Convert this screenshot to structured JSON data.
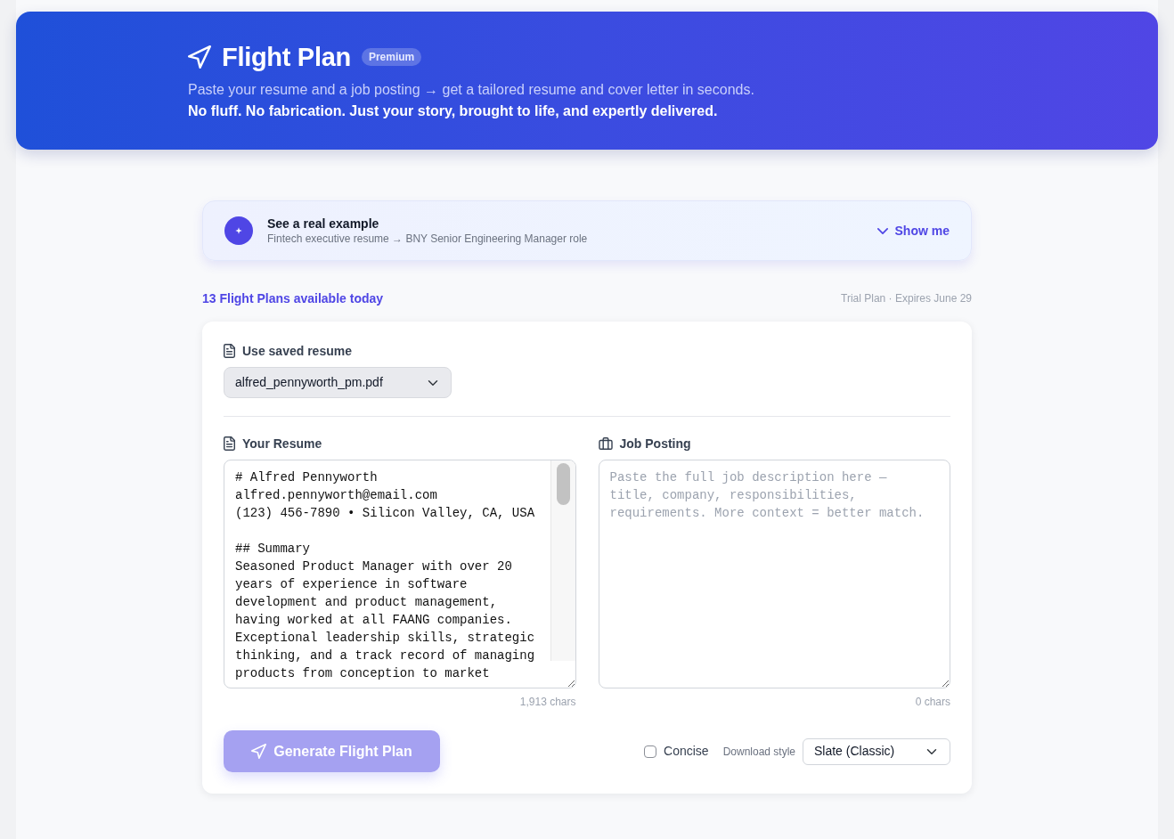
{
  "header": {
    "title": "Flight Plan",
    "badge": "Premium",
    "tagline": "Paste your resume and a job posting → get a tailored resume and cover letter in seconds.",
    "subline": "No fluff. No fabrication. Just your story, brought to life, and expertly delivered."
  },
  "example_banner": {
    "title": "See a real example",
    "subtitle": "Fintech executive resume → BNY Senior Engineering Manager role",
    "toggle": "Show me",
    "expanded": false
  },
  "status": {
    "available": "13 Flight Plans available today",
    "plan": "Trial Plan · Expires June 29"
  },
  "form": {
    "saved_resume": {
      "label": "Use saved resume",
      "value": "alfred_pennyworth_pm.pdf"
    },
    "inputs": [
      {
        "kind": "resume",
        "label": "Your Resume",
        "value": "# Alfred Pennyworth\nalfred.pennyworth@email.com\n(123) 456-7890 • Silicon Valley, CA, USA\n\n## Summary\nSeasoned Product Manager with over 20 years of experience in software development and product management, having worked at all FAANG companies. Exceptional leadership skills, strategic thinking, and a track record of managing products from conception to market",
        "count": "1,913 chars"
      },
      {
        "kind": "job",
        "label": "Job Posting",
        "placeholder": "Paste the full job description here — title, company, responsibilities, requirements. More context = better match.",
        "count": "0 chars"
      }
    ],
    "generate_button": {
      "label": "Generate Flight Plan",
      "disabled": true
    },
    "concise": {
      "label": "Concise",
      "checked": false
    },
    "download_style": {
      "label": "Download style",
      "value": "Slate (Classic)"
    }
  }
}
